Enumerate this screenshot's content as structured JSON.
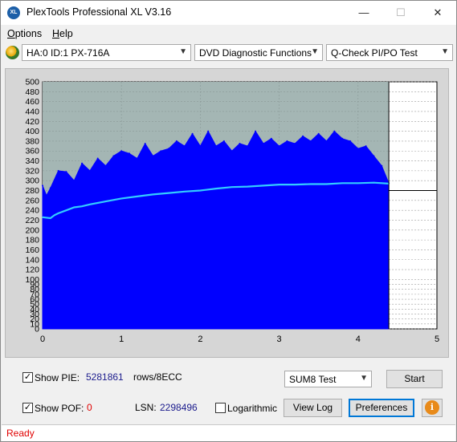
{
  "window": {
    "title": "PlexTools Professional XL V3.16",
    "icon_text": "XL",
    "controls": {
      "minimize": "—",
      "maximize": "☐",
      "close": "✕"
    }
  },
  "menu": [
    {
      "label": "Options",
      "key": "O"
    },
    {
      "label": "Help",
      "key": "H"
    }
  ],
  "toolbar": {
    "drive": "HA:0 ID:1  PX-716A",
    "function": "DVD Diagnostic Functions",
    "test": "Q-Check PI/PO Test"
  },
  "chart_data": {
    "type": "area",
    "title": "",
    "xlabel": "",
    "ylabel": "",
    "xlim": [
      0,
      5
    ],
    "ylim": [
      0,
      500
    ],
    "x_ticks": [
      "0",
      "1",
      "2",
      "3",
      "4",
      "5"
    ],
    "y_ticks": [
      "0",
      "10",
      "20",
      "30",
      "40",
      "50",
      "60",
      "70",
      "80",
      "90",
      "100",
      "120",
      "140",
      "160",
      "180",
      "200",
      "220",
      "240",
      "260",
      "280",
      "300",
      "320",
      "340",
      "360",
      "380",
      "400",
      "420",
      "440",
      "460",
      "480",
      "500"
    ],
    "grid": true,
    "test_end_x": 4.39,
    "end_marker_y": 280,
    "series": [
      {
        "color": "#0000ff",
        "x": [
          0,
          0.05,
          0.1,
          0.2,
          0.3,
          0.4,
          0.5,
          0.6,
          0.7,
          0.8,
          0.9,
          1.0,
          1.1,
          1.2,
          1.3,
          1.4,
          1.5,
          1.6,
          1.7,
          1.8,
          1.9,
          2.0,
          2.1,
          2.2,
          2.3,
          2.4,
          2.5,
          2.6,
          2.7,
          2.8,
          2.9,
          3.0,
          3.1,
          3.2,
          3.3,
          3.4,
          3.5,
          3.6,
          3.7,
          3.8,
          3.9,
          4.0,
          4.1,
          4.2,
          4.3,
          4.39
        ],
        "values": [
          290,
          270,
          285,
          320,
          318,
          300,
          335,
          320,
          345,
          330,
          350,
          360,
          355,
          345,
          375,
          350,
          360,
          365,
          380,
          370,
          395,
          370,
          400,
          370,
          380,
          360,
          375,
          370,
          400,
          375,
          385,
          370,
          380,
          375,
          390,
          380,
          395,
          380,
          400,
          385,
          380,
          365,
          370,
          350,
          330,
          295
        ]
      },
      {
        "color": "#33ccff",
        "x": [
          0,
          0.1,
          0.15,
          0.2,
          0.3,
          0.4,
          0.5,
          0.6,
          0.8,
          1.0,
          1.2,
          1.4,
          1.6,
          1.8,
          2.0,
          2.2,
          2.4,
          2.6,
          2.8,
          3.0,
          3.2,
          3.4,
          3.6,
          3.8,
          4.0,
          4.2,
          4.3,
          4.39
        ],
        "values": [
          226,
          224,
          230,
          234,
          240,
          246,
          248,
          252,
          258,
          264,
          268,
          272,
          275,
          278,
          280,
          284,
          287,
          288,
          290,
          292,
          292,
          293,
          293,
          295,
          295,
          296,
          295,
          294
        ]
      }
    ]
  },
  "controls": {
    "show_pie_label": "Show PIE:",
    "pie_value": "5281861",
    "pie_unit": "rows/8ECC",
    "show_pof_label": "Show POF:",
    "pof_value": "0",
    "lsn_label": "LSN:",
    "lsn_value": "2298496",
    "logarithmic_label": "Logarithmic",
    "sum_select": "SUM8 Test",
    "start": "Start",
    "view_log": "View Log",
    "preferences": "Preferences",
    "info_icon": "info-icon",
    "check_mark": "✓"
  },
  "status": "Ready"
}
